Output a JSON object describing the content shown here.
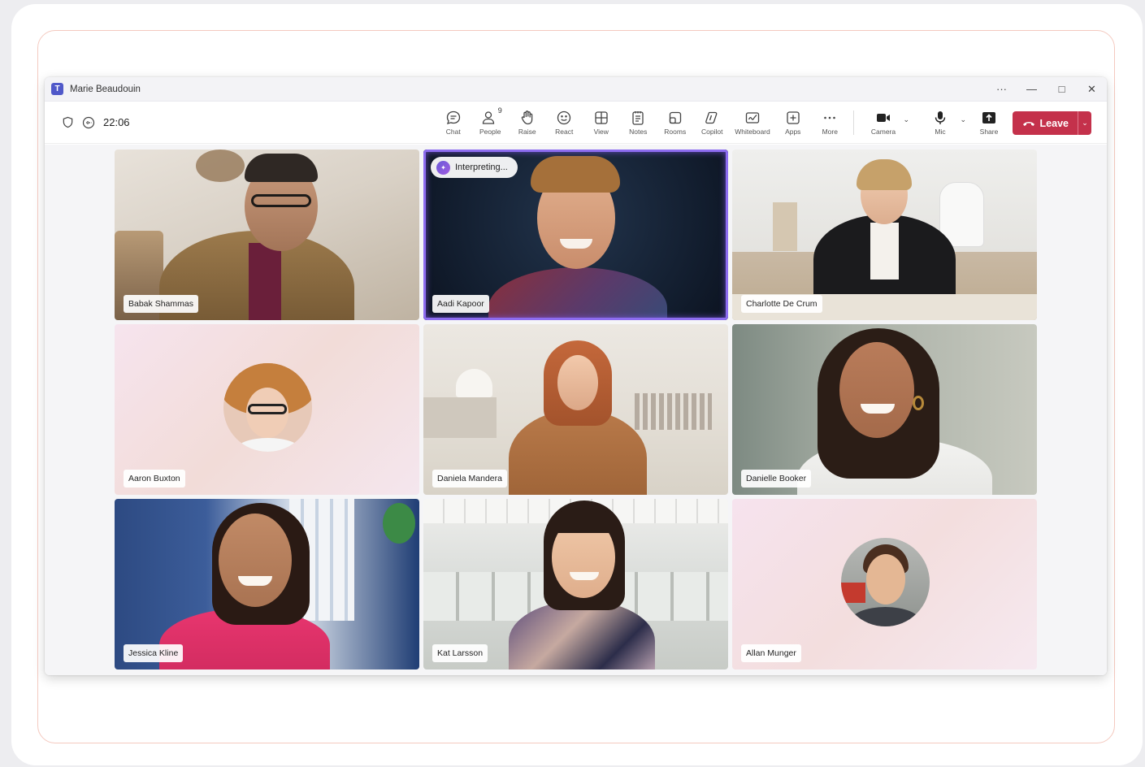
{
  "window": {
    "title": "Marie Beaudouin",
    "controls": [
      "more-icon",
      "minimize-icon",
      "maximize-icon",
      "close-icon"
    ]
  },
  "meeting": {
    "timer": "22:06"
  },
  "toolbar": {
    "chat": "Chat",
    "people": "People",
    "people_count": "9",
    "raise": "Raise",
    "react": "React",
    "view": "View",
    "notes": "Notes",
    "rooms": "Rooms",
    "copilot": "Copilot",
    "whiteboard": "Whiteboard",
    "apps": "Apps",
    "more": "More",
    "camera": "Camera",
    "mic": "Mic",
    "share": "Share",
    "leave": "Leave"
  },
  "colors": {
    "leave": "#c4314b",
    "brand": "#5059c9",
    "active_speaker": "#8d6cf0"
  },
  "participants": [
    {
      "name": "Babak Shammas"
    },
    {
      "name": "Aadi Kapoor",
      "badge": "Interpreting..."
    },
    {
      "name": "Charlotte De Crum"
    },
    {
      "name": "Aaron Buxton"
    },
    {
      "name": "Daniela Mandera"
    },
    {
      "name": "Danielle Booker"
    },
    {
      "name": "Jessica Kline"
    },
    {
      "name": "Kat Larsson"
    },
    {
      "name": "Allan Munger"
    }
  ]
}
